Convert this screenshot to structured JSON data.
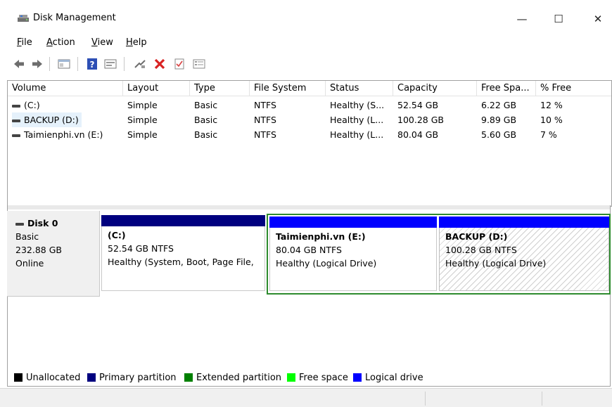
{
  "window": {
    "title": "Disk Management",
    "minimize": "—",
    "maximize": "☐",
    "close": "✕"
  },
  "menu": {
    "file": {
      "u": "F",
      "rest": "ile"
    },
    "action": {
      "u": "A",
      "rest": "ction"
    },
    "view": {
      "u": "V",
      "rest": "iew"
    },
    "help": {
      "u": "H",
      "rest": "elp"
    }
  },
  "toolbar_icons": [
    "back-arrow-icon",
    "forward-arrow-icon",
    "console-tree-icon",
    "help-icon",
    "properties-icon",
    "connect-icon",
    "delete-icon",
    "check-icon",
    "list-view-icon"
  ],
  "volumes": {
    "headers": [
      "Volume",
      "Layout",
      "Type",
      "File System",
      "Status",
      "Capacity",
      "Free Spa...",
      "% Free"
    ],
    "rows": [
      [
        "(C:)",
        "Simple",
        "Basic",
        "NTFS",
        "Healthy (S...",
        "52.54 GB",
        "6.22 GB",
        "12 %"
      ],
      [
        "BACKUP (D:)",
        "Simple",
        "Basic",
        "NTFS",
        "Healthy (L...",
        "100.28 GB",
        "9.89 GB",
        "10 %"
      ],
      [
        "Taimienphi.vn (E:)",
        "Simple",
        "Basic",
        "NTFS",
        "Healthy (L...",
        "80.04 GB",
        "5.60 GB",
        "7 %"
      ]
    ]
  },
  "disk": {
    "name": "Disk 0",
    "type": "Basic",
    "size": "232.88 GB",
    "status": "Online"
  },
  "partitions": [
    {
      "name": "(C:)",
      "size_fs": "52.54 GB NTFS",
      "status": "Healthy (System, Boot, Page File,",
      "bar_color": "#00007f"
    },
    {
      "name": "Taimienphi.vn  (E:)",
      "size_fs": "80.04 GB NTFS",
      "status": "Healthy (Logical Drive)",
      "bar_color": "#0000ff"
    },
    {
      "name": "BACKUP  (D:)",
      "size_fs": "100.28 GB NTFS",
      "status": "Healthy (Logical Drive)",
      "bar_color": "#0000ff"
    }
  ],
  "legend": [
    {
      "label": "Unallocated",
      "color": "#000000"
    },
    {
      "label": "Primary partition",
      "color": "#00007f"
    },
    {
      "label": "Extended partition",
      "color": "#008000"
    },
    {
      "label": "Free space",
      "color": "#00ff00"
    },
    {
      "label": "Logical drive",
      "color": "#0000ff"
    }
  ],
  "colors": {
    "extended_border": "#2e8b2e",
    "selection_bg": "#e5f1fb"
  }
}
